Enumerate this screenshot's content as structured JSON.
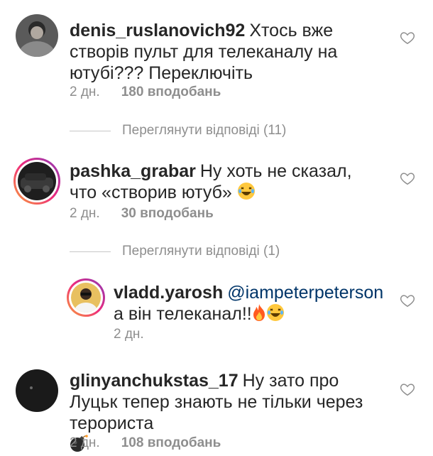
{
  "comments": [
    {
      "username": "denis_ruslanovich92",
      "text": "Хтось вже створів пульт для телеканалу на ютубі??? Переключіть",
      "time": "2 дн.",
      "likes": "180 вподобань"
    },
    {
      "username": "pashka_grabar",
      "text": "Ну хоть не сказал, что «створив ютуб»",
      "time": "2 дн.",
      "likes": "30 вподобань"
    },
    {
      "username": "glinyanchukstas_17",
      "text": "Ну зато про Луцьк тепер знають не тільки через терориста",
      "time": "2 дн.",
      "likes": "108 вподобань"
    }
  ],
  "reply": {
    "username": "vladd.yarosh",
    "mention": "@iampeterpeterson",
    "text": "а він телеканал!!",
    "time": "2 дн."
  },
  "view_replies": [
    "Переглянути відповіді (11)",
    "Переглянути відповіді (1)"
  ],
  "colors": {
    "text": "#262626",
    "muted": "#8e8e8e",
    "mention": "#003569"
  },
  "icons": {
    "like": "heart-outline-icon",
    "laugh": "laughing-emoji",
    "fire": "fire-emoji",
    "bomb": "bomb-emoji"
  }
}
